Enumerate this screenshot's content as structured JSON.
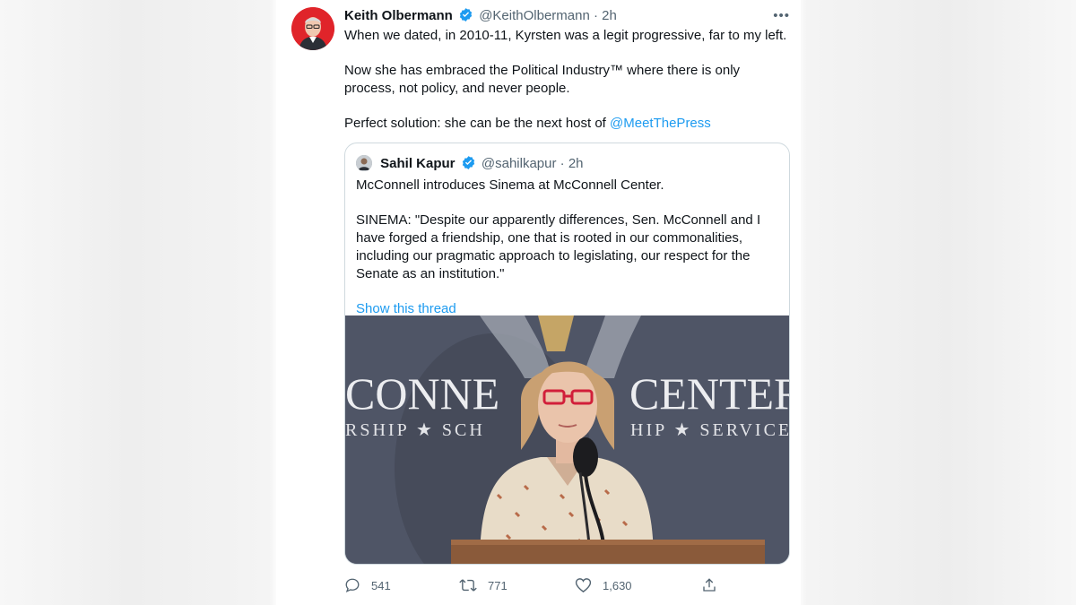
{
  "tweet": {
    "author_name": "Keith Olbermann",
    "handle": "@KeithOlbermann",
    "separator": "·",
    "time": "2h",
    "more_label": "•••",
    "text_p1": "When we dated, in 2010-11, Kyrsten was a legit progressive, far to my left.",
    "text_p2": "Now she has embraced the Political Industry™ where there is only process, not policy, and never people.",
    "text_p3_prefix": "Perfect solution: she can be the next host of ",
    "text_p3_mention": "@MeetThePress"
  },
  "quote": {
    "author_name": "Sahil Kapur",
    "handle": "@sahilkapur",
    "separator": "·",
    "time": "2h",
    "text_p1": "McConnell introduces Sinema at McConnell Center.",
    "text_p2": "SINEMA: \"Despite our apparently differences, Sen. McConnell and I have forged a friendship, one that is rooted in our commonalities, including our pragmatic approach to legislating, our respect for the Senate as an institution.\"",
    "show_thread": "Show this thread",
    "media_backdrop": {
      "line1": "CONNE",
      "line1b": "CENTER",
      "line2": "RSHIP ★ SCH",
      "line2b": "HIP ★ SERVICE"
    }
  },
  "actions": {
    "reply_count": "541",
    "retweet_count": "771",
    "like_count": "1,630"
  },
  "colors": {
    "link": "#1d9bf0",
    "muted": "#536471",
    "verified": "#1d9bf0",
    "avatar_bg": "#e0242a"
  },
  "icons": {
    "verified": "verified-badge-icon",
    "reply": "reply-icon",
    "retweet": "retweet-icon",
    "like": "heart-icon",
    "share": "share-icon"
  }
}
